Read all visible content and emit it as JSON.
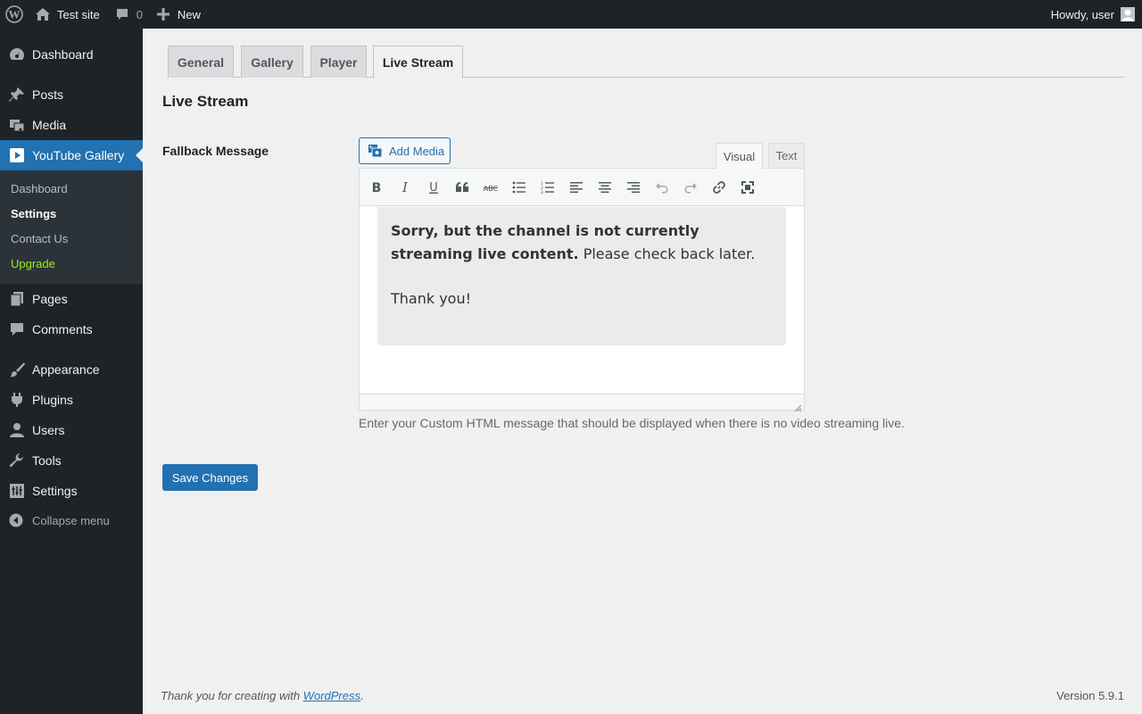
{
  "admin_bar": {
    "site_name": "Test site",
    "comments_count": "0",
    "new_label": "New",
    "greeting": "Howdy, user"
  },
  "sidebar": {
    "items": [
      {
        "label": "Dashboard",
        "icon": "dashboard-icon"
      },
      {
        "label": "Posts",
        "icon": "pushpin-icon"
      },
      {
        "label": "Media",
        "icon": "media-icon"
      },
      {
        "label": "YouTube Gallery",
        "icon": "youtube-icon"
      },
      {
        "label": "Pages",
        "icon": "pages-icon"
      },
      {
        "label": "Comments",
        "icon": "comment-icon"
      },
      {
        "label": "Appearance",
        "icon": "brush-icon"
      },
      {
        "label": "Plugins",
        "icon": "plugin-icon"
      },
      {
        "label": "Users",
        "icon": "user-icon"
      },
      {
        "label": "Tools",
        "icon": "wrench-icon"
      },
      {
        "label": "Settings",
        "icon": "settings-icon"
      }
    ],
    "submenu": [
      {
        "label": "Dashboard"
      },
      {
        "label": "Settings"
      },
      {
        "label": "Contact Us"
      },
      {
        "label": "Upgrade"
      }
    ],
    "upgrade_glyph": "",
    "collapse_label": "Collapse menu"
  },
  "tabs": [
    {
      "label": "General"
    },
    {
      "label": "Gallery"
    },
    {
      "label": "Player"
    },
    {
      "label": "Live Stream"
    }
  ],
  "section_title": "Live Stream",
  "field": {
    "label": "Fallback Message",
    "add_media_label": "Add Media",
    "mode_visual": "Visual",
    "mode_text": "Text",
    "content_bold": "Sorry, but the channel is not currently streaming live content.",
    "content_rest": "Please check back later.",
    "content_thanks": "Thank you!",
    "help": "Enter your Custom HTML message that should be displayed when there is no video streaming live."
  },
  "save_label": "Save Changes",
  "footer": {
    "thanks_prefix": "Thank you for creating with ",
    "thanks_link": "WordPress",
    "thanks_suffix": ".",
    "version": "Version 5.9.1"
  },
  "colors": {
    "admin_bar": "#1d2327",
    "accent": "#2271b1",
    "background": "#f0f0f1",
    "upgrade": "#9ef01a"
  }
}
